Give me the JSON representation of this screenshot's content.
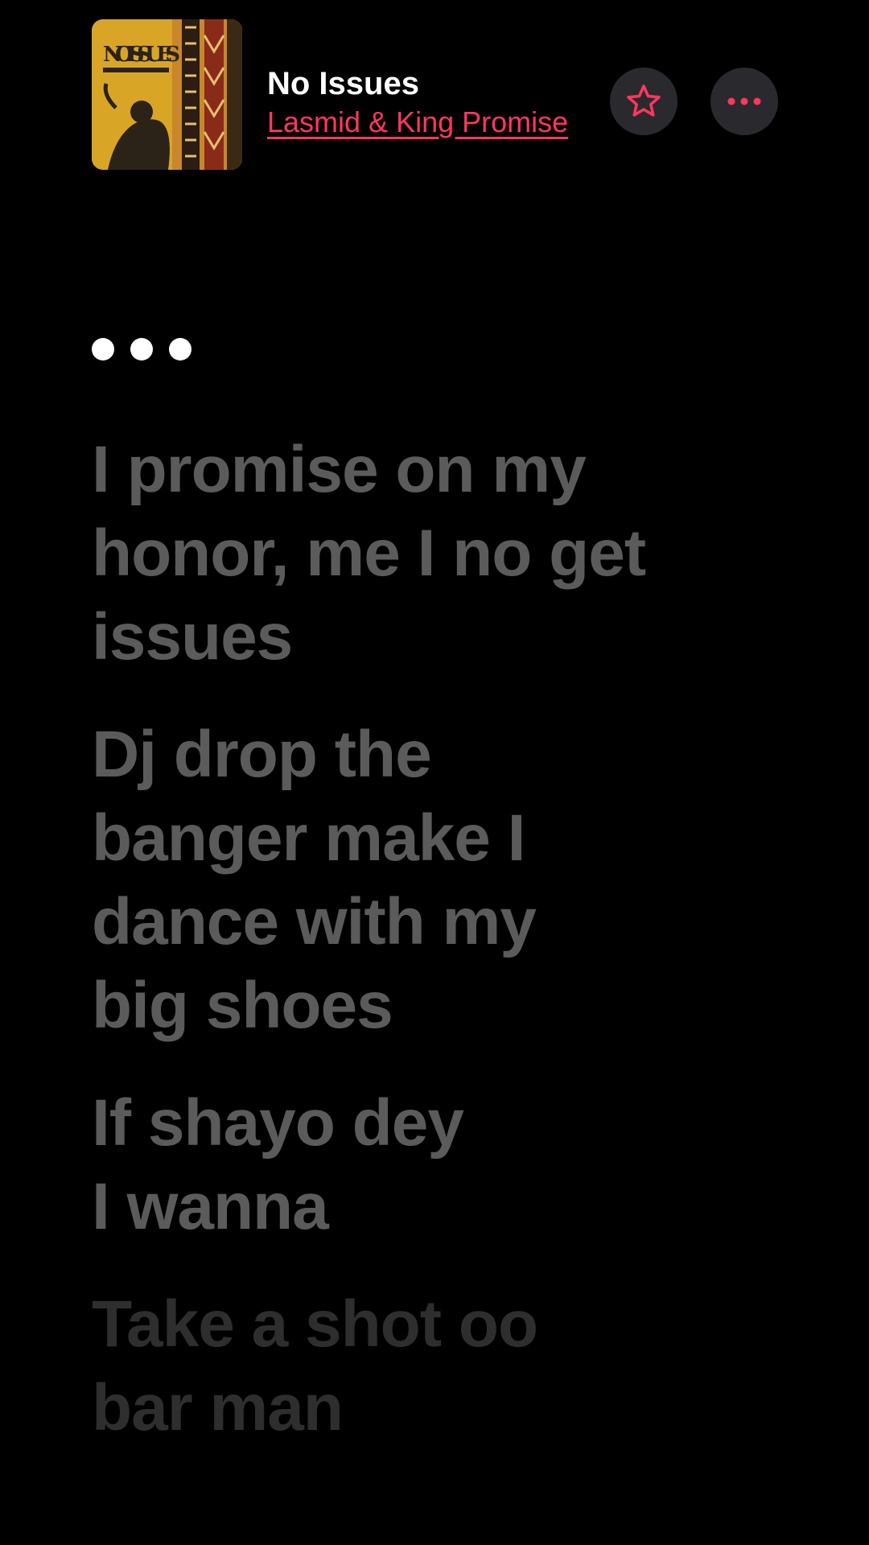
{
  "song": {
    "title": "No Issues",
    "artist": "Lasmid & King Promise",
    "artwork_text": "NO ISSUES"
  },
  "buttons": {
    "favorite_icon": "star-icon",
    "more_icon": "ellipsis-icon"
  },
  "colors": {
    "accent": "#ff375f",
    "background": "#000000",
    "button_bg": "#2a2a2e",
    "lyric_dim": "#5b5b5b",
    "lyric_fading": "#2e2e2e"
  },
  "lyrics": {
    "indicator_icon": "three-dots-indicator",
    "lines": [
      [
        "I promise on my",
        "honor, me I no get",
        "issues"
      ],
      [
        "Dj drop the",
        "banger make I",
        "dance with my",
        "big shoes"
      ],
      [
        "If shayo dey",
        "I wanna"
      ],
      [
        "Take a shot oo",
        "bar man"
      ]
    ]
  }
}
